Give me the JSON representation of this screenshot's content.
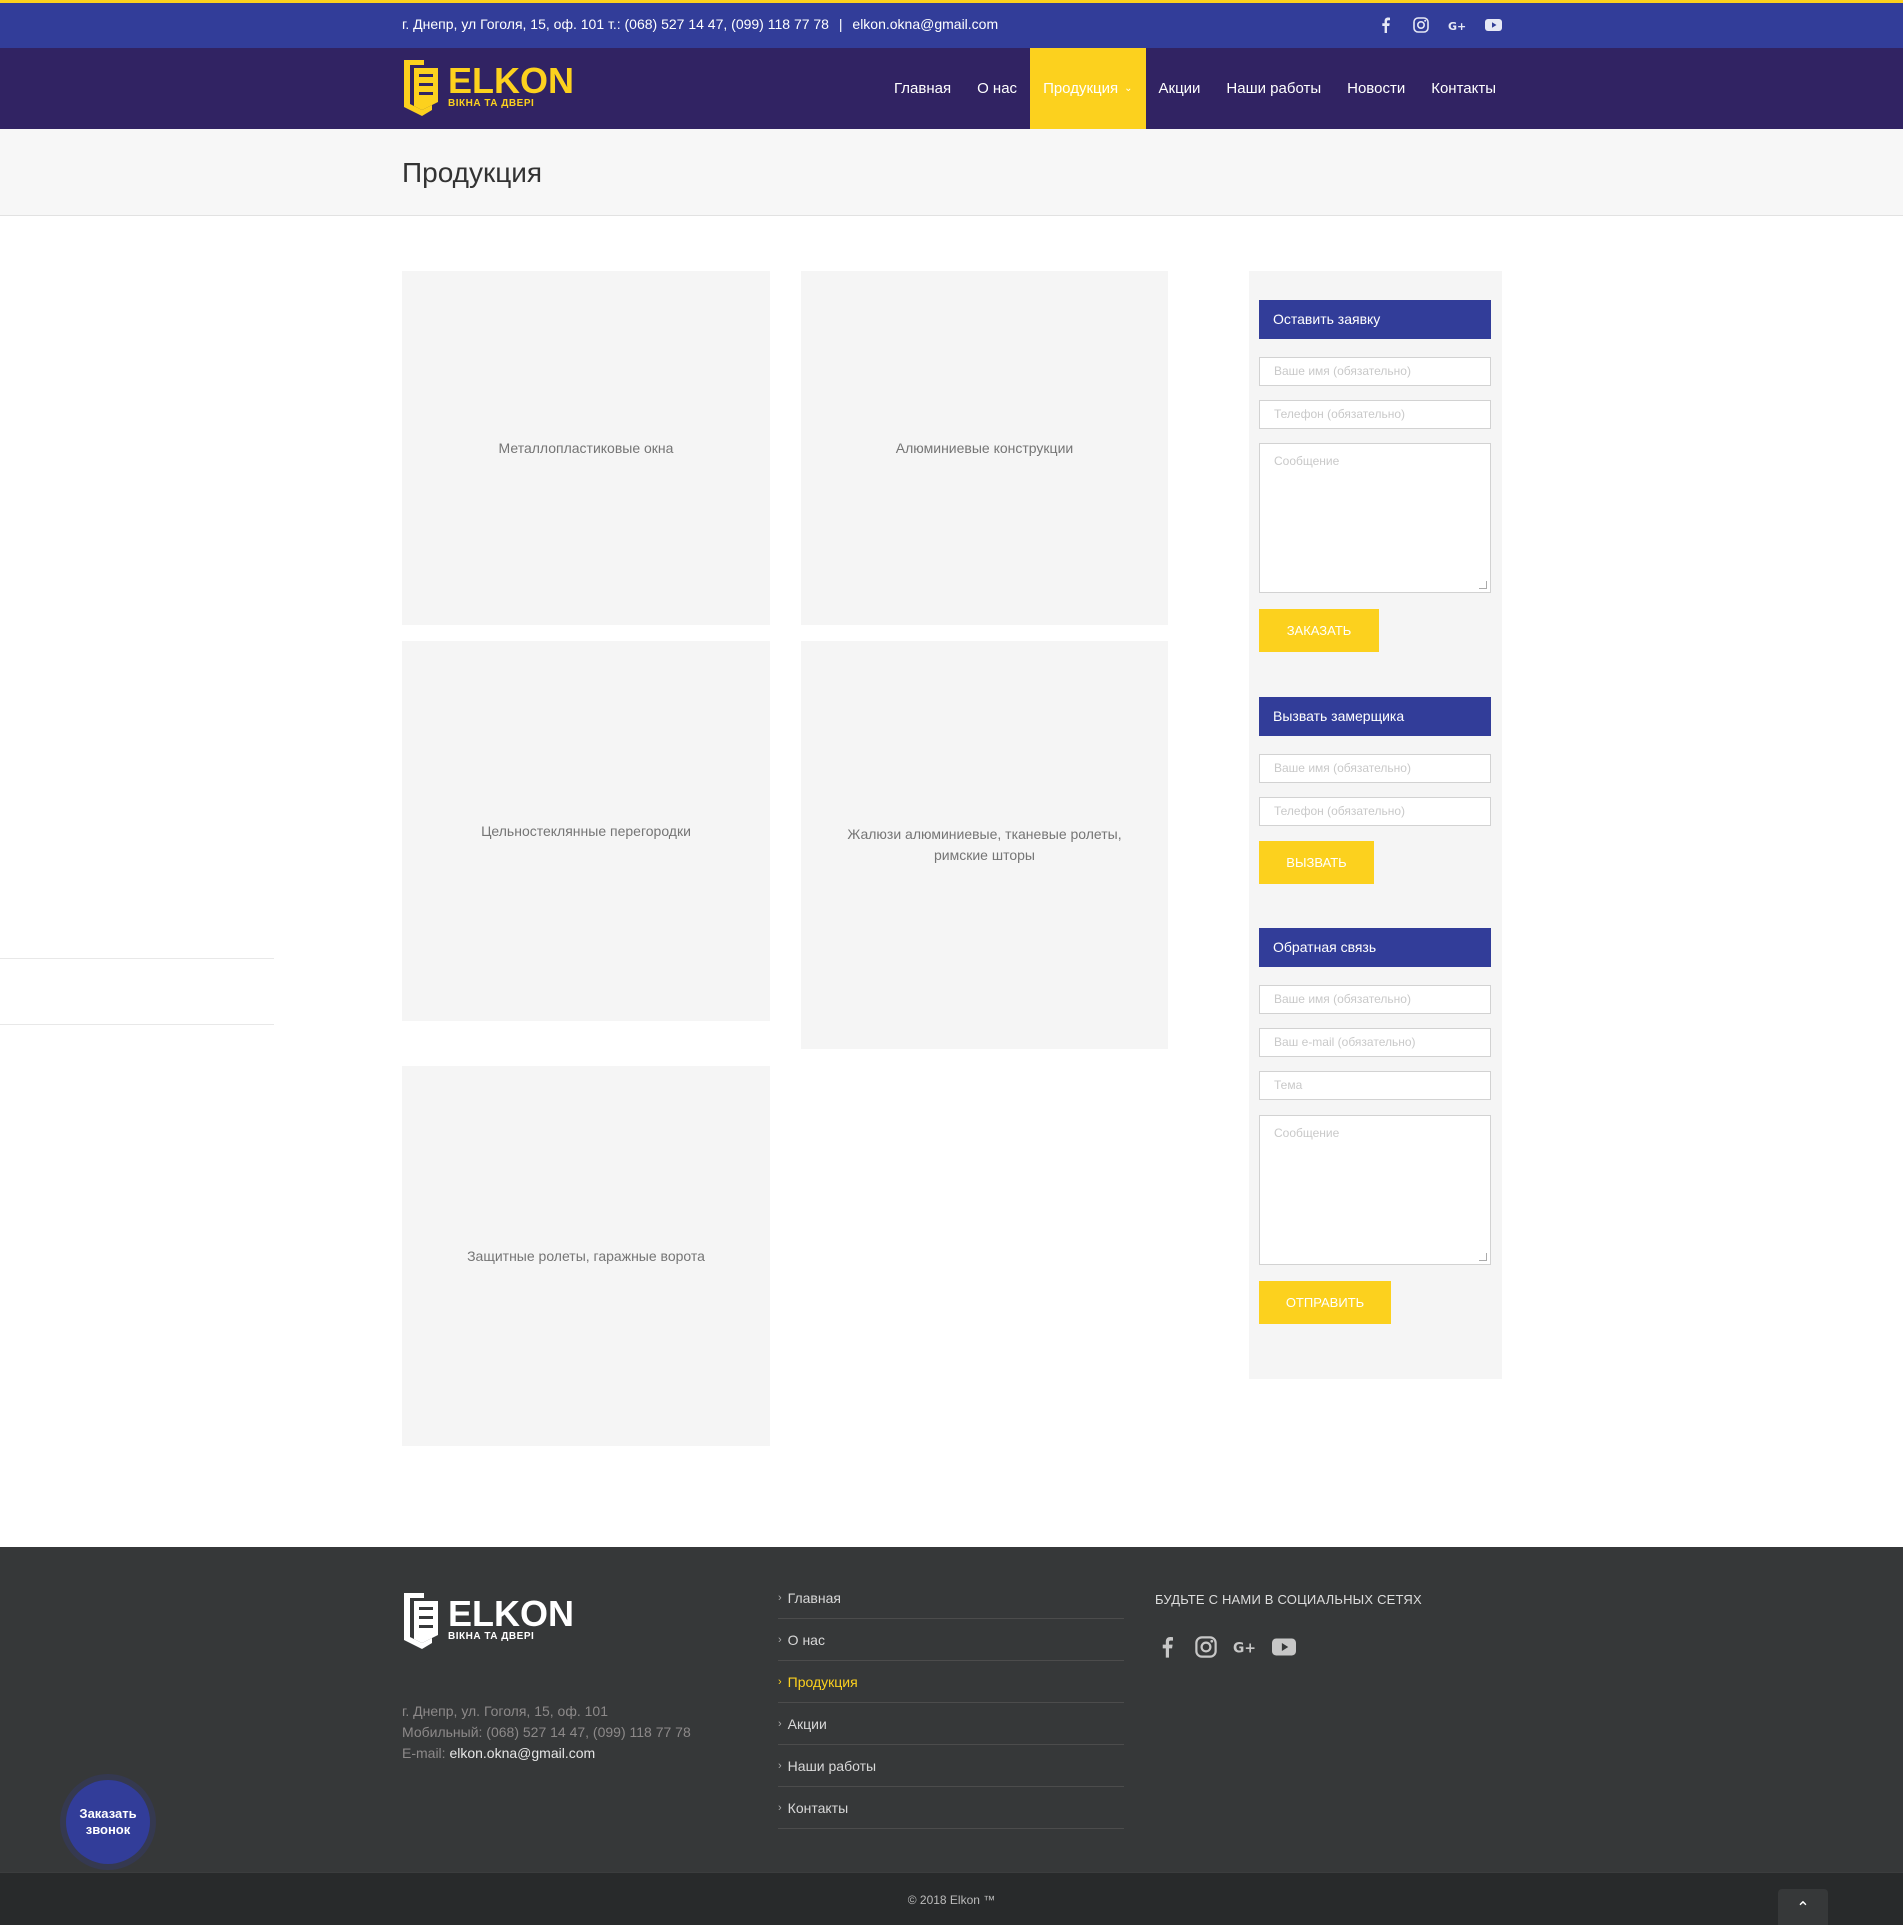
{
  "topbar": {
    "address_phones": "г. Днепр, ул Гоголя, 15, оф. 101 т.: (068) 527 14 47, (099) 118 77 78",
    "separator": "|",
    "email": "elkon.okna@gmail.com",
    "socials": [
      "facebook-icon",
      "instagram-icon",
      "google-plus-icon",
      "youtube-icon"
    ]
  },
  "logo": {
    "name": "ELKON",
    "tagline": "ВІКНА ТА ДВЕРІ"
  },
  "nav": {
    "items": [
      {
        "label": "Главная"
      },
      {
        "label": "О нас"
      },
      {
        "label": "Продукция",
        "active": true
      },
      {
        "label": "Акции"
      },
      {
        "label": "Наши работы"
      },
      {
        "label": "Новости"
      },
      {
        "label": "Контакты"
      }
    ]
  },
  "page": {
    "title": "Продукция"
  },
  "products": [
    {
      "label": "Металлопластиковые окна"
    },
    {
      "label": "Алюминиевые конструкции"
    },
    {
      "label": "Цельностеклянные перегородки"
    },
    {
      "label": "Жалюзи алюминиевые, тканевые ролеты, римские шторы"
    },
    {
      "label": "Защитные ролеты, гаражные ворота"
    }
  ],
  "sidebar": {
    "order": {
      "title": "Оставить заявку",
      "name_placeholder": "Ваше имя (обязательно)",
      "phone_placeholder": "Телефон (обязательно)",
      "message_placeholder": "Сообщение",
      "button": "ЗАКАЗАТЬ"
    },
    "measure": {
      "title": "Вызвать замерщика",
      "name_placeholder": "Ваше имя (обязательно)",
      "phone_placeholder": "Телефон (обязательно)",
      "button": "ВЫЗВАТЬ"
    },
    "feedback": {
      "title": "Обратная связь",
      "name_placeholder": "Ваше имя (обязательно)",
      "email_placeholder": "Ваш e-mail (обязательно)",
      "subject_placeholder": "Тема",
      "message_placeholder": "Сообщение",
      "button": "ОТПРАВИТЬ"
    }
  },
  "footer": {
    "address": "г. Днепр, ул. Гоголя, 15, оф. 101",
    "mobile": "Мобильный: (068) 527 14 47, (099) 118 77 78",
    "email_label": "E-mail:",
    "email": "elkon.okna@gmail.com",
    "menu": [
      {
        "label": "Главная"
      },
      {
        "label": "О нас"
      },
      {
        "label": "Продукция",
        "active": true
      },
      {
        "label": "Акции"
      },
      {
        "label": "Наши работы"
      },
      {
        "label": "Контакты"
      }
    ],
    "social_title": "БУДЬТЕ С НАМИ В СОЦИАЛЬНЫХ СЕТЯХ",
    "copyright": "© 2018 Elkon ™"
  },
  "callback": {
    "line1": "Заказать",
    "line2": "звонок"
  },
  "colors": {
    "brand_blue": "#323d99",
    "brand_dark": "#312363",
    "accent_yellow": "#fcd11e"
  }
}
